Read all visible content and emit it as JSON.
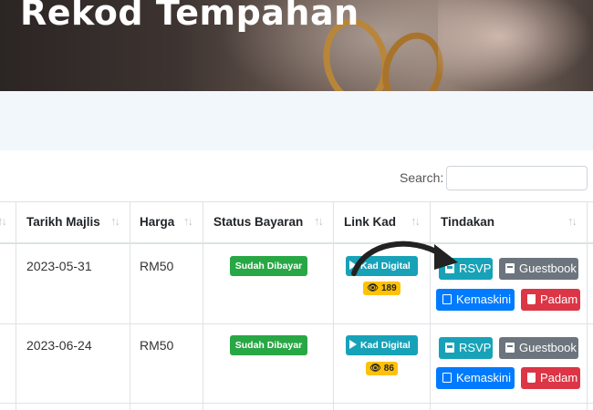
{
  "page": {
    "title": "Rekod Tempahan"
  },
  "search": {
    "label": "Search:",
    "value": ""
  },
  "table": {
    "headers": [
      "Tarikh Majlis",
      "Harga",
      "Status Bayaran",
      "Link Kad",
      "Tindakan"
    ],
    "rows": [
      {
        "date": "2023-05-31",
        "price": "RM50",
        "status": "Sudah Dibayar",
        "link_label": "Kad Digital",
        "views": "189",
        "actions": {
          "rsvp": "RSVP",
          "guestbook": "Guestbook",
          "edit": "Kemaskini",
          "delete": "Padam"
        }
      },
      {
        "date": "2023-06-24",
        "price": "RM50",
        "status": "Sudah Dibayar",
        "link_label": "Kad Digital",
        "views": "86",
        "actions": {
          "rsvp": "RSVP",
          "guestbook": "Guestbook",
          "edit": "Kemaskini",
          "delete": "Padam"
        }
      }
    ]
  },
  "colors": {
    "status": "#28a745",
    "link": "#17a2b8",
    "views": "#ffc107",
    "edit": "#007bff",
    "delete": "#dc3545",
    "guestbook": "#6c757d"
  }
}
